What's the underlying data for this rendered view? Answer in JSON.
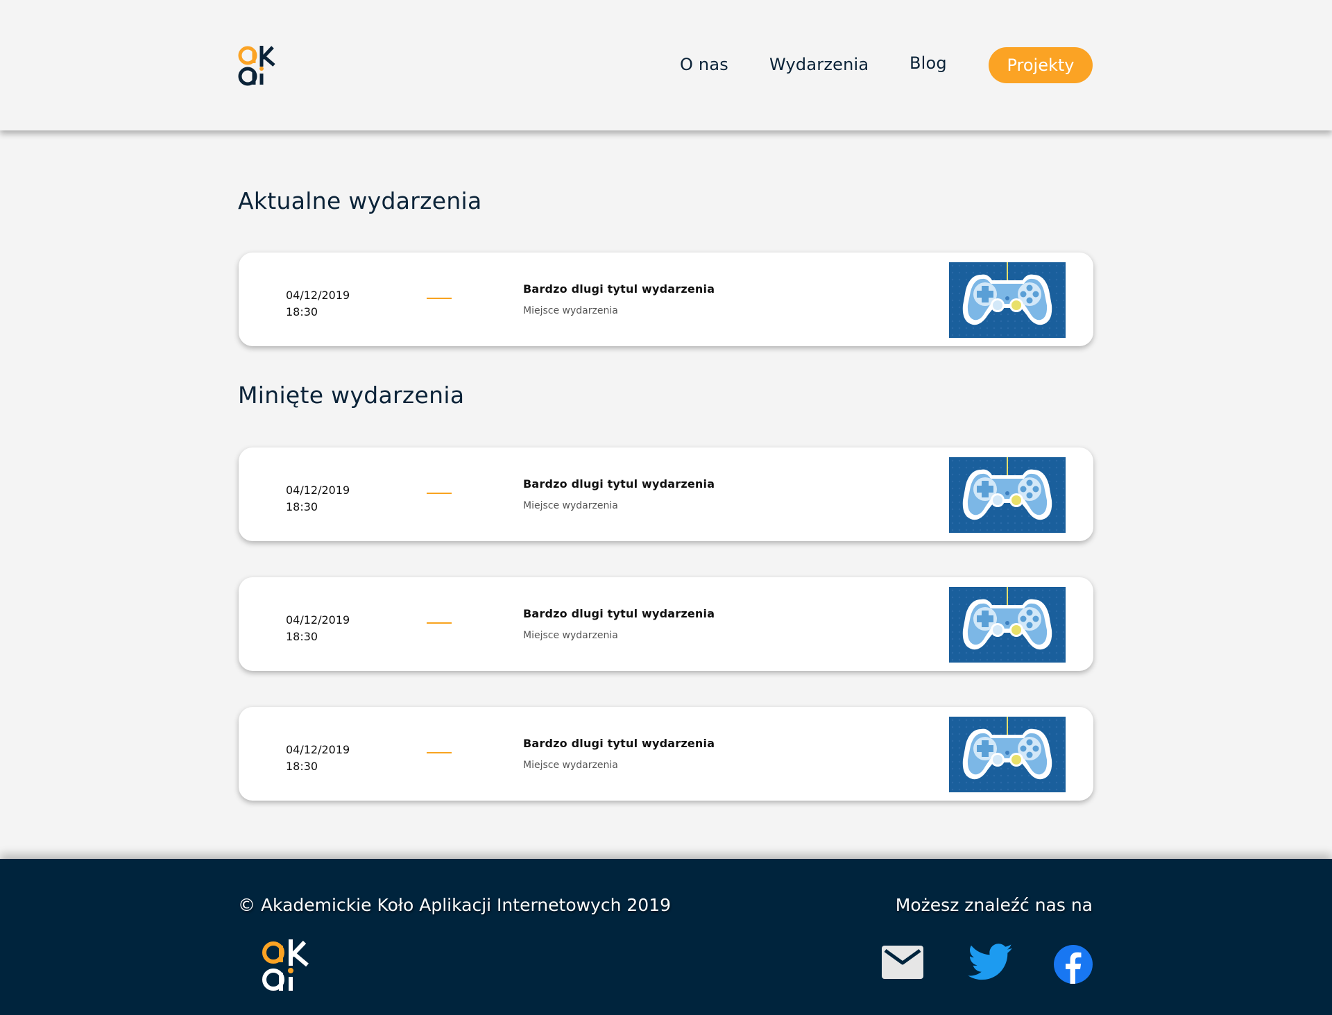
{
  "header": {
    "logo_alt": "akai",
    "nav": {
      "about": "O nas",
      "events": "Wydarzenia",
      "blog": "Blog",
      "projects": "Projekty"
    }
  },
  "sections": {
    "current_title": "Aktualne wydarzenia",
    "past_title": "Minięte wydarzenia"
  },
  "current_events": [
    {
      "date": "04/12/2019",
      "time": "18:30",
      "title": "Bardzo dlugi tytul wydarzenia",
      "place": "Miejsce wydarzenia",
      "image_icon": "gamepad-icon"
    }
  ],
  "past_events": [
    {
      "date": "04/12/2019",
      "time": "18:30",
      "title": "Bardzo dlugi tytul wydarzenia",
      "place": "Miejsce wydarzenia",
      "image_icon": "gamepad-icon"
    },
    {
      "date": "04/12/2019",
      "time": "18:30",
      "title": "Bardzo dlugi tytul wydarzenia",
      "place": "Miejsce wydarzenia",
      "image_icon": "gamepad-icon"
    },
    {
      "date": "04/12/2019",
      "time": "18:30",
      "title": "Bardzo dlugi tytul wydarzenia",
      "place": "Miejsce wydarzenia",
      "image_icon": "gamepad-icon"
    }
  ],
  "footer": {
    "copyright": "© Akademickie Koło Aplikacji Internetowych 2019",
    "find_us": "Możesz znaleźć nas na",
    "social_icons": [
      "mail-icon",
      "twitter-icon",
      "facebook-icon"
    ]
  },
  "colors": {
    "accent": "#fba324",
    "navy": "#0b2338",
    "footer_bg": "#00243d",
    "background": "#f4f4f4",
    "twitter": "#1d9bf0",
    "facebook": "#1877f2"
  }
}
